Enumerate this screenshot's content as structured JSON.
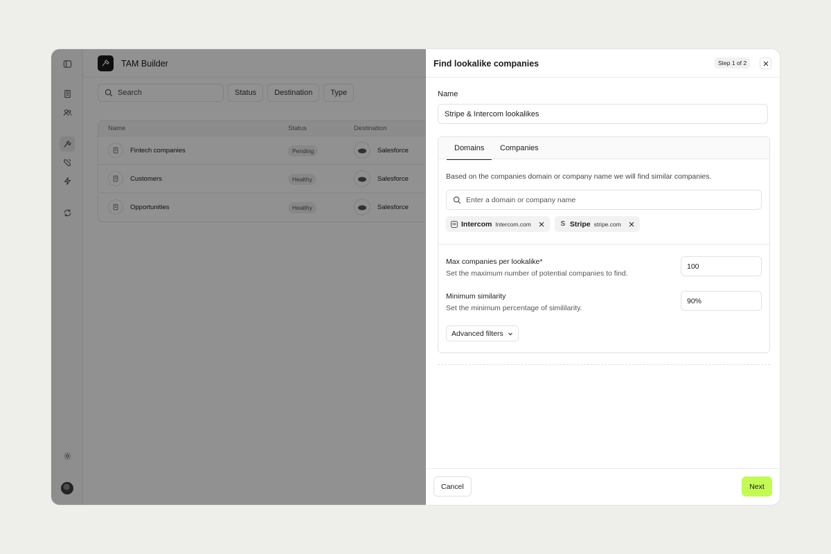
{
  "app": {
    "title": "TAM Builder",
    "search_placeholder": "Search",
    "filters": [
      "Status",
      "Destination",
      "Type"
    ],
    "table": {
      "columns": [
        "Name",
        "Status",
        "Destination"
      ],
      "rows": [
        {
          "name": "Fintech companies",
          "status": "Pending",
          "destination": "Salesforce"
        },
        {
          "name": "Customers",
          "status": "Healthy",
          "destination": "Salesforce"
        },
        {
          "name": "Opportunities",
          "status": "Healthy",
          "destination": "Salesforce"
        }
      ]
    }
  },
  "dialog": {
    "title": "Find lookalike companies",
    "step": "Step 1 of 2",
    "name_label": "Name",
    "name_value": "Stripe & Intercom lookalikes",
    "tabs": [
      "Domains",
      "Companies"
    ],
    "active_tab": "Domains",
    "description": "Based on the companies domain or company name we will find similar companies.",
    "domain_placeholder": "Enter a domain or company name",
    "chips": [
      {
        "name": "Intercom",
        "domain": "Intercom.com",
        "icon": "intercom-logo-icon"
      },
      {
        "name": "Stripe",
        "domain": "stripe.com",
        "icon": "stripe-logo-icon",
        "glyph": "S"
      }
    ],
    "max_companies": {
      "label": "Max companies per lookalike*",
      "help": "Set the maximum number of potential companies to find.",
      "value": "100"
    },
    "min_similarity": {
      "label": "Minimum similarity",
      "help": "Set the minimum percentage of simililarity.",
      "value": "90%"
    },
    "advanced_filters": "Advanced filters",
    "cancel": "Cancel",
    "next": "Next"
  },
  "colors": {
    "accent": "#c3fa55",
    "background": "#eeefeb",
    "overlay": "rgba(0,0,0,0.43)"
  }
}
